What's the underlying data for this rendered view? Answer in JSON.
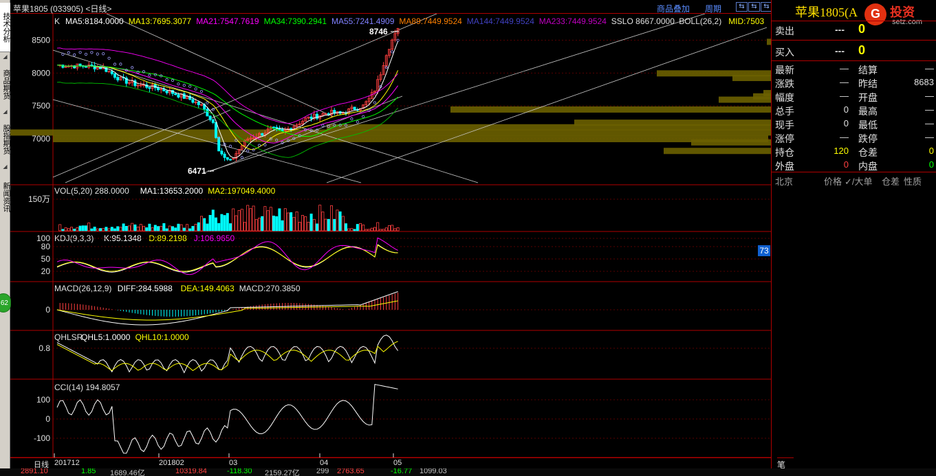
{
  "window": {
    "title": "苹果1805 (033905) <日线>",
    "links": [
      "商品叠加",
      "周期"
    ],
    "nav_buttons": [
      "⇆",
      "⇆",
      "⇆"
    ]
  },
  "left_tabs": [
    "技术分析",
    "商品期货",
    "股指期货",
    "新闻资讯"
  ],
  "float_badge": "62",
  "main_indicator": {
    "label": "K",
    "items": [
      {
        "text": "MA5:8184.0000",
        "color": "#ffffff"
      },
      {
        "text": "MA13:7695.3077",
        "color": "#ffff00"
      },
      {
        "text": "MA21:7547.7619",
        "color": "#ff00ff"
      },
      {
        "text": "MA34:7390.2941",
        "color": "#00ff00"
      },
      {
        "text": "MA55:7241.4909",
        "color": "#8080ff"
      },
      {
        "text": "MA89:7449.9524",
        "color": "#ff8000"
      },
      {
        "text": "MA144:7449.9524",
        "color": "#4040c0"
      },
      {
        "text": "MA233:7449.9524",
        "color": "#c000c0"
      },
      {
        "text": "SSLO 8667.0000",
        "color": "#e0e0e0"
      },
      {
        "text": "BOLL(26,2)",
        "color": "#e0e0e0"
      },
      {
        "text": "MID:7503",
        "color": "#ffff00"
      }
    ],
    "price_ticks": [
      "8500",
      "8000",
      "7500",
      "7000"
    ],
    "high_label": "8746",
    "low_label": "6471"
  },
  "volume_indicator": {
    "items": [
      {
        "text": "VOL(5,20) 288.0000",
        "color": "#e0e0e0"
      },
      {
        "text": "MA1:13653.2000",
        "color": "#ffffff"
      },
      {
        "text": "MA2:197049.4000",
        "color": "#ffff00"
      }
    ],
    "tick": "150万"
  },
  "kdj_indicator": {
    "items": [
      {
        "text": "KDJ(9,3,3)",
        "color": "#e0e0e0"
      },
      {
        "text": "K:95.1348",
        "color": "#ffffff"
      },
      {
        "text": "D:89.2198",
        "color": "#ffff00"
      },
      {
        "text": "J:106.9650",
        "color": "#ff00ff"
      }
    ],
    "ticks": [
      "100",
      "80",
      "50",
      "20"
    ],
    "badge": "73"
  },
  "macd_indicator": {
    "items": [
      {
        "text": "MACD(26,12,9)",
        "color": "#e0e0e0"
      },
      {
        "text": "DIFF:284.5988",
        "color": "#ffffff"
      },
      {
        "text": "DEA:149.4063",
        "color": "#ffff00"
      },
      {
        "text": "MACD:270.3850",
        "color": "#e0e0e0"
      }
    ],
    "tick": "0"
  },
  "qhlsr_indicator": {
    "items": [
      {
        "text": "QHLSR",
        "color": "#e0e0e0"
      },
      {
        "text": "QHL5:1.0000",
        "color": "#ffffff"
      },
      {
        "text": "QHL10:1.0000",
        "color": "#ffff00"
      }
    ],
    "tick": "0.8"
  },
  "cci_indicator": {
    "items": [
      {
        "text": "CCI(14) 194.8057",
        "color": "#e0e0e0"
      }
    ],
    "ticks": [
      "100",
      "0",
      "-100"
    ]
  },
  "x_axis": {
    "period_label": "日线",
    "dates": [
      "201712",
      "201802",
      "03",
      "04",
      "05"
    ]
  },
  "quote_panel": {
    "title": "苹果1805(A",
    "title_suffix": "05)",
    "logo_text": "投资",
    "logo_letter": "G",
    "logo_sub": "setz.com",
    "sell_label": "卖出",
    "sell_price": "---",
    "sell_qty": "0",
    "buy_label": "买入",
    "buy_price": "---",
    "buy_qty": "0",
    "rows": [
      {
        "l1": "最新",
        "v1": "—",
        "c1": "#e0e0e0",
        "l2": "结算",
        "v2": "—",
        "c2": "#e0e0e0"
      },
      {
        "l1": "涨跌",
        "v1": "—",
        "c1": "#e0e0e0",
        "l2": "昨结",
        "v2": "8683",
        "c2": "#e0e0e0"
      },
      {
        "l1": "幅度",
        "v1": "—",
        "c1": "#e0e0e0",
        "l2": "开盘",
        "v2": "—",
        "c2": "#e0e0e0"
      },
      {
        "l1": "总手",
        "v1": "0",
        "c1": "#e0e0e0",
        "l2": "最高",
        "v2": "—",
        "c2": "#e0e0e0"
      },
      {
        "l1": "现手",
        "v1": "0",
        "c1": "#e0e0e0",
        "l2": "最低",
        "v2": "—",
        "c2": "#e0e0e0"
      },
      {
        "l1": "涨停",
        "v1": "—",
        "c1": "#e0e0e0",
        "l2": "跌停",
        "v2": "—",
        "c2": "#e0e0e0"
      },
      {
        "l1": "持仓",
        "v1": "120",
        "c1": "#ffff00",
        "l2": "仓差",
        "v2": "0",
        "c2": "#ffff00"
      },
      {
        "l1": "外盘",
        "v1": "0",
        "c1": "#ff4040",
        "l2": "内盘",
        "v2": "0",
        "c2": "#00ff00"
      }
    ],
    "tick_headers": [
      "北京",
      "价格",
      "✓/大单",
      "仓差",
      "性质"
    ],
    "pen_tab": "笔"
  },
  "ticker": [
    {
      "text": "2891.10",
      "color": "#ff4040"
    },
    {
      "text": "1.85",
      "color": "#00ff00"
    },
    {
      "text": "1689.46亿",
      "color": "#c0c0c0"
    },
    {
      "text": "10319.84",
      "color": "#ff4040"
    },
    {
      "text": "-118.30",
      "color": "#00ff00"
    },
    {
      "text": "2159.27亿",
      "color": "#c0c0c0"
    },
    {
      "text": "299",
      "color": "#c0c0c0"
    },
    {
      "text": "2763.65",
      "color": "#ff4040"
    },
    {
      "text": "-16.77",
      "color": "#00ff00"
    },
    {
      "text": "1099.03",
      "color": "#c0c0c0"
    }
  ]
}
